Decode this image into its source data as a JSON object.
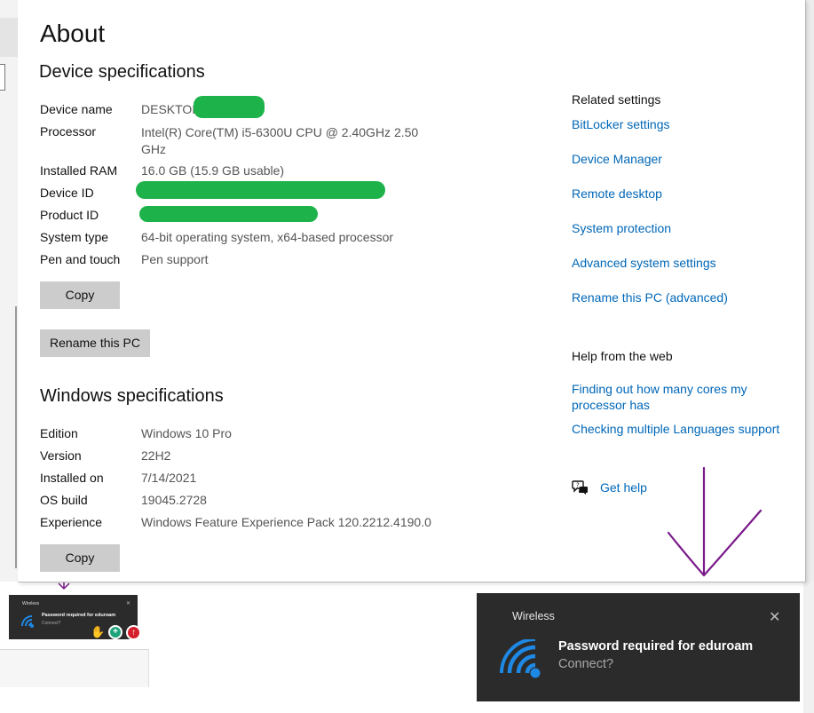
{
  "page": {
    "title": "About",
    "device_specs": {
      "heading": "Device specifications",
      "rows": [
        {
          "label": "Device name",
          "value": "DESKTOP"
        },
        {
          "label": "Processor",
          "value": "Intel(R) Core(TM) i5-6300U CPU @ 2.40GHz   2.50 GHz"
        },
        {
          "label": "Installed RAM",
          "value": "16.0 GB (15.9 GB usable)"
        },
        {
          "label": "Device ID",
          "value": ""
        },
        {
          "label": "Product ID",
          "value": ""
        },
        {
          "label": "System type",
          "value": "64-bit operating system, x64-based processor"
        },
        {
          "label": "Pen and touch",
          "value": "Pen support"
        }
      ],
      "copy_label": "Copy",
      "rename_label": "Rename this PC"
    },
    "windows_specs": {
      "heading": "Windows specifications",
      "rows": [
        {
          "label": "Edition",
          "value": "Windows 10 Pro"
        },
        {
          "label": "Version",
          "value": "22H2"
        },
        {
          "label": "Installed on",
          "value": "7/14/2021"
        },
        {
          "label": "OS build",
          "value": "19045.2728"
        },
        {
          "label": "Experience",
          "value": "Windows Feature Experience Pack 120.2212.4190.0"
        }
      ],
      "copy_label": "Copy"
    },
    "related_settings": {
      "heading": "Related settings",
      "links": [
        "BitLocker settings",
        "Device Manager",
        "Remote desktop",
        "System protection",
        "Advanced system settings",
        "Rename this PC (advanced)"
      ]
    },
    "help_web": {
      "heading": "Help from the web",
      "links": [
        "Finding out how many cores my processor has",
        "Checking multiple Languages support"
      ]
    },
    "get_help": "Get help"
  },
  "toast": {
    "app": "Wireless",
    "close": "✕",
    "message": "Password required for eduroam",
    "sub": "Connect?"
  },
  "mini_toast": {
    "app": "Wireless",
    "close": "✕",
    "message": "Password required for eduroam",
    "sub": "Connect?"
  },
  "colors": {
    "link": "#0067b8",
    "redaction": "#1db34a",
    "annotation_arrow": "#7a1a8a",
    "toast_bg": "#2b2b2b",
    "wifi_icon": "#1e88e5"
  },
  "icons": {
    "get_help": "help-chat-icon",
    "toast": "wifi-icon",
    "close": "close-icon"
  }
}
